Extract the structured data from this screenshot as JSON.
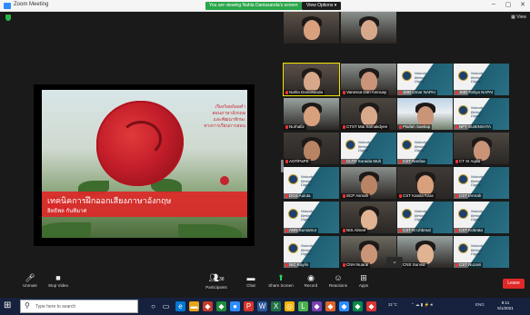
{
  "window": {
    "title": "Zoom Meeting",
    "share_banner": "You are viewing Nahla Daniasanda's screen",
    "view_options": "View Options ▾",
    "controls": [
      "–",
      "▢",
      "✕"
    ]
  },
  "meeting": {
    "view_label": "▦ View"
  },
  "slide": {
    "lines": [
      "เรียงร้อยถ้อยคำ",
      "สอนภาษาอังกฤษ",
      "และพัฒนาทักษะ",
      "ทางการเรียนการสอน"
    ],
    "title": "เทคนิคการฝึกออกเสียงภาษาอังกฤษ",
    "subtitle": "อิทธิพล กันทิมาศ"
  },
  "participants": [
    {
      "name": "Nahla Daniasanda",
      "kind": "person",
      "speaker": true
    },
    {
      "name": "Vanessa Dan Amnuay",
      "kind": "person"
    },
    {
      "name": "JMD Umar NAPAI",
      "kind": "logo"
    },
    {
      "name": "JMD Yahya NAPAI",
      "kind": "logo"
    },
    {
      "name": "Nurhafiz",
      "kind": "person"
    },
    {
      "name": "CTST Mai Samakdyee",
      "kind": "person"
    },
    {
      "name": "Plaifah Saetiap",
      "kind": "photo"
    },
    {
      "name": "NPT SUBINSATA",
      "kind": "logo"
    },
    {
      "name": "AOTiPaPE",
      "kind": "person"
    },
    {
      "name": "CLTD Suraida Muh",
      "kind": "logo"
    },
    {
      "name": "CST Nanfaa",
      "kind": "logo"
    },
    {
      "name": "CT SI Aqilla",
      "kind": "person"
    },
    {
      "name": "DGS Auluta",
      "kind": "logo"
    },
    {
      "name": "SCP Asmah",
      "kind": "person"
    },
    {
      "name": "CST Kanita Kara",
      "kind": "person"
    },
    {
      "name": "CST iAmrah",
      "kind": "logo"
    },
    {
      "name": "ANN Sumamur",
      "kind": "logo"
    },
    {
      "name": "NIS Almee",
      "kind": "person"
    },
    {
      "name": "CST M Uhbmal",
      "kind": "logo"
    },
    {
      "name": "CST Kobrata",
      "kind": "logo"
    },
    {
      "name": "NIC Kaylin",
      "kind": "logo"
    },
    {
      "name": "CNH Nuarai",
      "kind": "person"
    },
    {
      "name": "CNS Sunisa",
      "kind": "person"
    },
    {
      "name": "CST Nuzairi",
      "kind": "logo"
    },
    {
      "name": "",
      "kind": "person"
    },
    {
      "name": "",
      "kind": "person"
    }
  ],
  "logo_text": [
    "Nobody",
    "Behind",
    "Digital"
  ],
  "scroll_icon": "⌄",
  "toolbar": {
    "unmute": "Unmute",
    "stop_video": "Stop Video",
    "participants": "Participants",
    "participants_count": "38",
    "chat": "Chat",
    "share_screen": "Share Screen",
    "record": "Record",
    "reactions": "Reactions",
    "apps": "Apps",
    "leave": "Leave"
  },
  "taskbar": {
    "search_placeholder": "Type here to search",
    "tray_text": "ENG",
    "time": "8:11",
    "date": "5/1/2021",
    "weather": "31°C"
  }
}
